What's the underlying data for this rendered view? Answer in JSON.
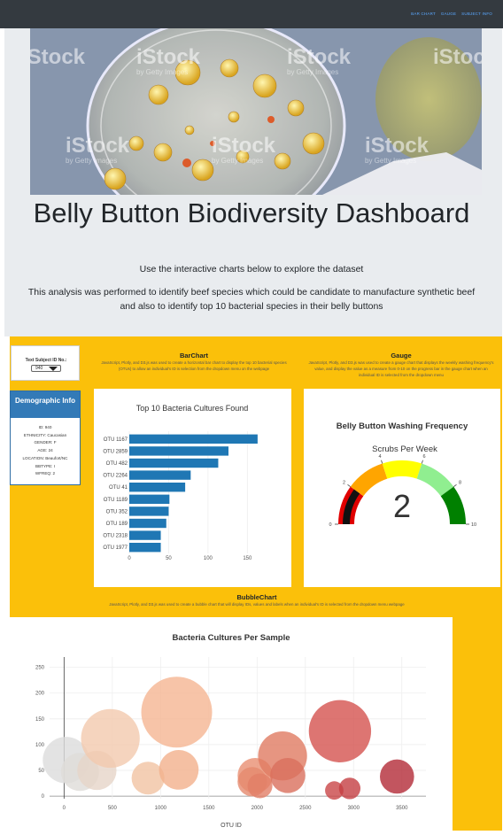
{
  "nav": {
    "links": [
      "BAR CHART",
      "GAUGE",
      "SUBJECT INFO"
    ]
  },
  "hero": {
    "watermark": "iStock",
    "watermark_sub": "by Getty Images"
  },
  "header": {
    "title": "Belly Button Biodiversity Dashboard",
    "subtitle": "Use the interactive charts below to explore the dataset",
    "description": "This analysis was performed to identify beef species which could be candidate to manufacture synthetic beef and also to identify top 10 bacterial species in their belly buttons"
  },
  "selector": {
    "label": "Text Subject ID No.:",
    "value": "940"
  },
  "demographic": {
    "title": "Demographic Info",
    "rows": [
      "ID: 940",
      "ETHNICITY: Caucasian",
      "GENDER: F",
      "AGE: 24",
      "LOCATION: Beaufort/NC",
      "BBTYPE: I",
      "WFREQ: 2"
    ]
  },
  "barchart_panel": {
    "title": "BarChart",
    "description": "JavaScript, Plotly, and D3.js was used to create a horizontal bar chart to display the top 10 bacterial species (OTUs) to allow an individual's ID is selection from the dropdown menu on the webpage"
  },
  "gauge_panel": {
    "title": "Gauge",
    "description": "JavaScript, Plotly, and D3.js was used to create a gauge chart that displays the weekly washing frequency's value, and display the value as a measure from 0-10 on the progress bar in the gauge chart when an individual ID is selected from the dropdown menu"
  },
  "bubble_panel": {
    "title": "BubbleChart",
    "description": "JavaScript, Plotly, and D3.js was used to create a bubble chart that will display IDs, values and labels when an individual's ID is selected from the dropdown menu webpage"
  },
  "gauge": {
    "title": "Belly Button Washing Frequency",
    "subtitle": "Scrubs Per Week",
    "value": "2",
    "ticks": [
      "0",
      "2",
      "4",
      "6",
      "8",
      "10"
    ],
    "colors": [
      "#e00000",
      "#ffa500",
      "#ffff00",
      "#90ee90",
      "#008000"
    ]
  },
  "chart_data": [
    {
      "type": "bar",
      "title": "Top 10 Bacteria Cultures Found",
      "categories": [
        "OTU 1167",
        "OTU 2859",
        "OTU 482",
        "OTU 2264",
        "OTU 41",
        "OTU 1189",
        "OTU 352",
        "OTU 189",
        "OTU 2318",
        "OTU 1977"
      ],
      "values": [
        163,
        126,
        113,
        78,
        71,
        51,
        50,
        47,
        40,
        40
      ],
      "xticks": [
        "0",
        "50",
        "100",
        "150"
      ],
      "xlim": [
        0,
        180
      ],
      "color": "#1f77b4"
    },
    {
      "type": "scatter",
      "title": "Bacteria Cultures Per Sample",
      "xlabel": "OTU ID",
      "xticks": [
        "0",
        "500",
        "1000",
        "1500",
        "2000",
        "2500",
        "3000",
        "3500"
      ],
      "yticks": [
        "0",
        "50",
        "100",
        "150",
        "200",
        "250"
      ],
      "xlim": [
        -150,
        3750
      ],
      "ylim": [
        -5,
        270
      ],
      "points": [
        {
          "x": 20,
          "y": 70,
          "c": "#dcdcdc"
        },
        {
          "x": 165,
          "y": 47,
          "c": "#dedcd8"
        },
        {
          "x": 340,
          "y": 50,
          "c": "#e6d5c8"
        },
        {
          "x": 480,
          "y": 112,
          "c": "#f2c9ae"
        },
        {
          "x": 870,
          "y": 35,
          "c": "#f1c3a2"
        },
        {
          "x": 1167,
          "y": 163,
          "c": "#f5b592"
        },
        {
          "x": 1189,
          "y": 51,
          "c": "#f3b08c"
        },
        {
          "x": 1980,
          "y": 40,
          "c": "#e98f72"
        },
        {
          "x": 1950,
          "y": 28,
          "c": "#e58a6e"
        },
        {
          "x": 2030,
          "y": 20,
          "c": "#e27e66"
        },
        {
          "x": 2264,
          "y": 78,
          "c": "#e07a62"
        },
        {
          "x": 2318,
          "y": 40,
          "c": "#d96f5c"
        },
        {
          "x": 2859,
          "y": 126,
          "c": "#d4524f"
        },
        {
          "x": 2800,
          "y": 11,
          "c": "#c94647"
        },
        {
          "x": 2960,
          "y": 15,
          "c": "#c43e42"
        },
        {
          "x": 3450,
          "y": 38,
          "c": "#b32b37"
        }
      ]
    }
  ]
}
